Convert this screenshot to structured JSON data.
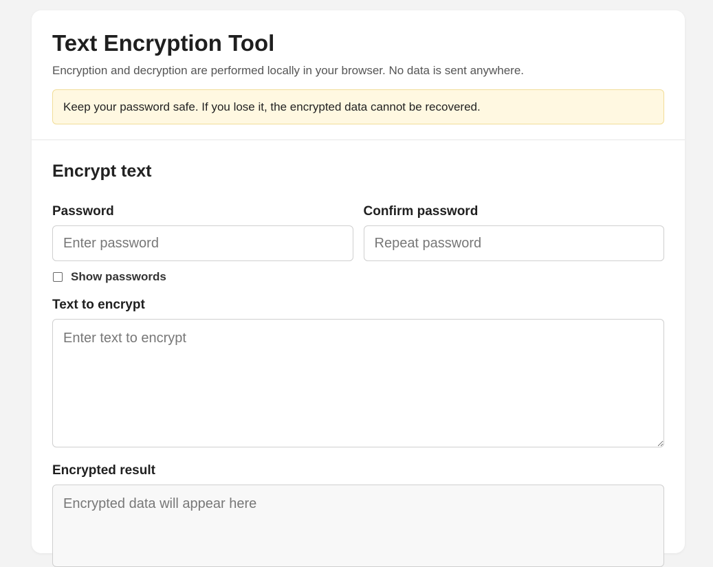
{
  "header": {
    "title": "Text Encryption Tool",
    "subtitle": "Encryption and decryption are performed locally in your browser. No data is sent anywhere.",
    "warning": "Keep your password safe. If you lose it, the encrypted data cannot be recovered."
  },
  "encrypt": {
    "section_title": "Encrypt text",
    "password": {
      "label": "Password",
      "placeholder": "Enter password",
      "value": ""
    },
    "confirm_password": {
      "label": "Confirm password",
      "placeholder": "Repeat password",
      "value": ""
    },
    "show_passwords": {
      "label": "Show passwords",
      "checked": false
    },
    "text": {
      "label": "Text to encrypt",
      "placeholder": "Enter text to encrypt",
      "value": ""
    },
    "result": {
      "label": "Encrypted result",
      "placeholder": "Encrypted data will appear here",
      "value": ""
    }
  },
  "colors": {
    "page_background": "#f3f3f3",
    "card_background": "#ffffff",
    "warning_background": "#fff8e1",
    "warning_border": "#f1dd98"
  }
}
